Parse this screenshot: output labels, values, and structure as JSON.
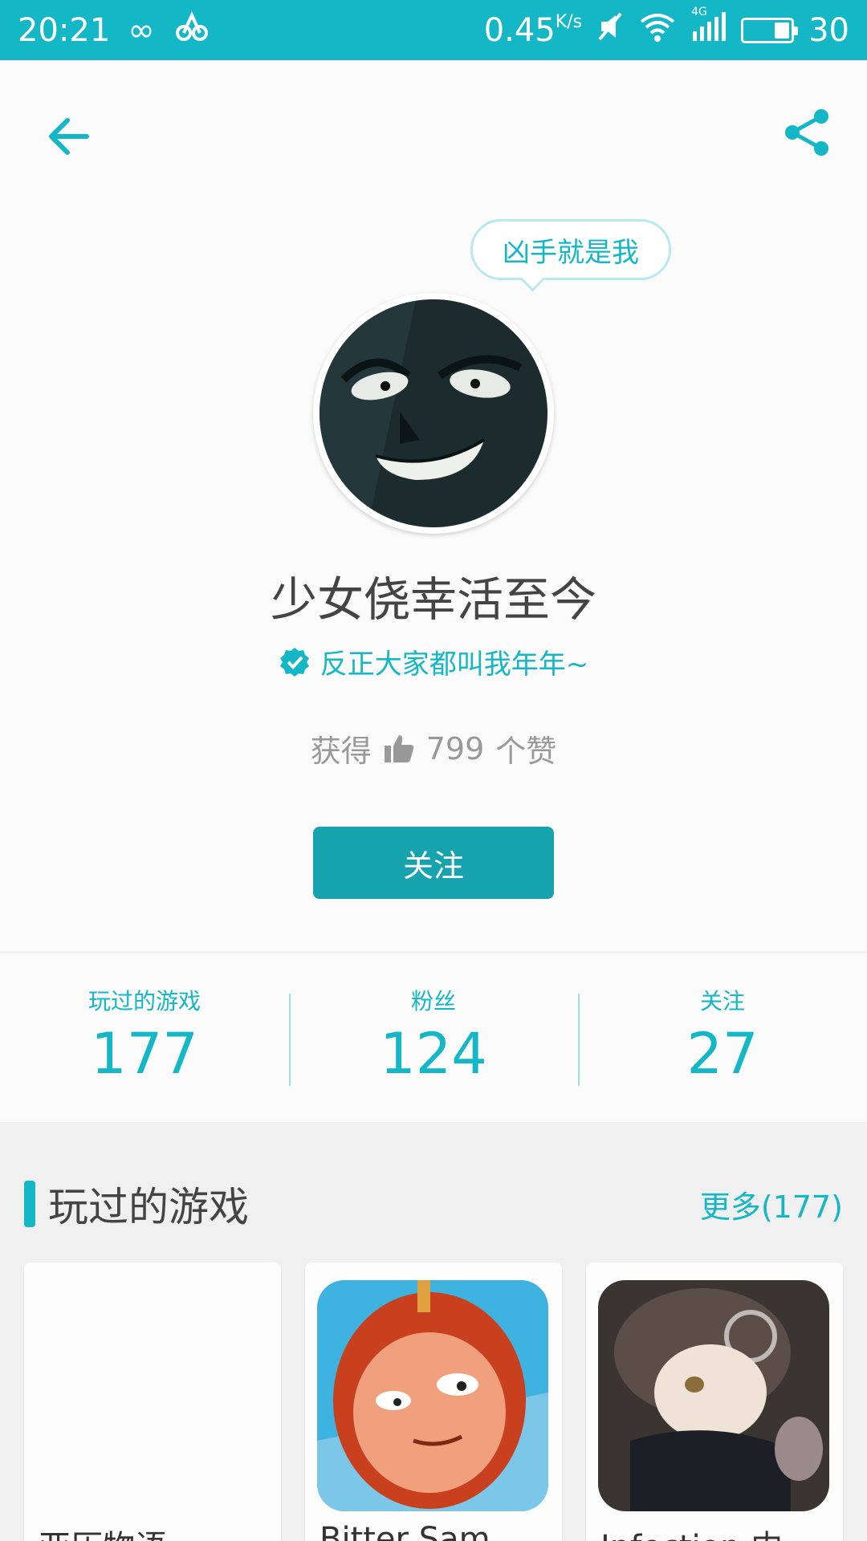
{
  "status_bar": {
    "time": "20:21",
    "speed": "0.45",
    "speed_unit": "K/s",
    "network": "4G",
    "battery": "30",
    "icons": [
      "infinity-icon",
      "bluetooth-like-icon",
      "mute-icon",
      "wifi-icon",
      "signal-icon",
      "battery-icon"
    ]
  },
  "header": {
    "back_icon": "arrow-left-icon",
    "share_icon": "share-icon"
  },
  "profile": {
    "bubble_text": "凶手就是我",
    "username": "少女侥幸活至今",
    "signature": "反正大家都叫我年年~",
    "likes_prefix": "获得",
    "likes_count": "799",
    "likes_suffix": "个赞",
    "follow_label": "关注"
  },
  "stats": [
    {
      "label": "玩过的游戏",
      "value": "177"
    },
    {
      "label": "粉丝",
      "value": "124"
    },
    {
      "label": "关注",
      "value": "27"
    }
  ],
  "games_section": {
    "title": "玩过的游戏",
    "more": "更多(177)",
    "games": [
      {
        "name": "亚历物语"
      },
      {
        "name": "Bitter Sam"
      },
      {
        "name": "Infection 内"
      }
    ]
  },
  "colors": {
    "accent": "#13b7c5",
    "button": "#16a3ae"
  }
}
